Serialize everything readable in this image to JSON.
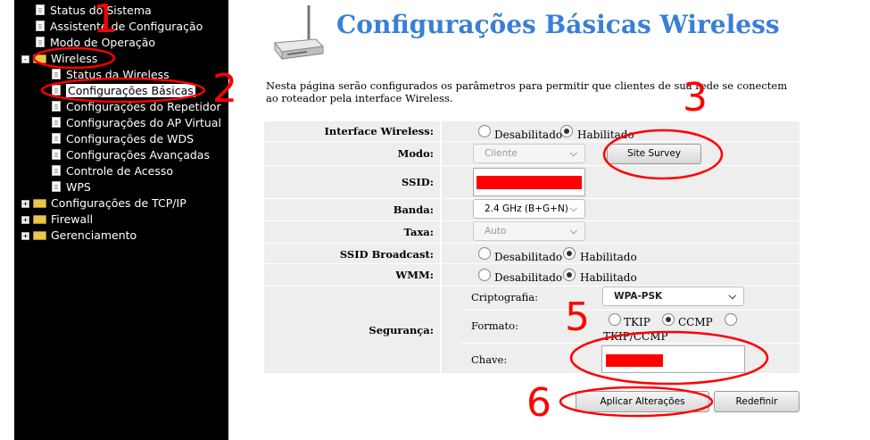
{
  "sidebar": {
    "items": [
      {
        "label": "Status do Sistema",
        "icon": "document-icon"
      },
      {
        "label": "Assistente de Configuração",
        "icon": "document-icon"
      },
      {
        "label": "Modo de Operação",
        "icon": "document-icon"
      },
      {
        "label": "Wireless",
        "icon": "folder-open-icon",
        "expander": "-"
      },
      {
        "label": "Status da Wireless",
        "icon": "document-icon"
      },
      {
        "label": "Configurações Básicas",
        "icon": "document-icon",
        "selected": true
      },
      {
        "label": "Configurações do Repetidor",
        "icon": "document-icon"
      },
      {
        "label": "Configurações do AP Virtual",
        "icon": "document-icon"
      },
      {
        "label": "Configurações de WDS",
        "icon": "document-icon"
      },
      {
        "label": "Configurações Avançadas",
        "icon": "document-icon"
      },
      {
        "label": "Controle de Acesso",
        "icon": "document-icon"
      },
      {
        "label": "WPS",
        "icon": "document-icon"
      },
      {
        "label": "Configurações de TCP/IP",
        "icon": "folder-icon",
        "expander": "+"
      },
      {
        "label": "Firewall",
        "icon": "folder-icon",
        "expander": "+"
      },
      {
        "label": "Gerenciamento",
        "icon": "folder-icon",
        "expander": "+"
      }
    ]
  },
  "header": {
    "title": "Configurações Básicas Wireless",
    "description": "Nesta página serão configurados os parâmetros para permitir que clientes de sua rede se conectem ao roteador pela interface Wireless."
  },
  "form": {
    "interface": {
      "label": "Interface Wireless:",
      "opt1": "Desabilitado",
      "opt2": "Habilitado",
      "selected": "Habilitado"
    },
    "modo": {
      "label": "Modo:",
      "value": "Cliente",
      "button": "Site Survey"
    },
    "ssid": {
      "label": "SSID:"
    },
    "banda": {
      "label": "Banda:",
      "value": "2.4 GHz (B+G+N)"
    },
    "taxa": {
      "label": "Taxa:",
      "value": "Auto"
    },
    "broadcast": {
      "label": "SSID Broadcast:",
      "opt1": "Desabilitado",
      "opt2": "Habilitado",
      "selected": "Habilitado"
    },
    "wmm": {
      "label": "WMM:",
      "opt1": "Desabilitado",
      "opt2": "Habilitado",
      "selected": "Habilitado"
    },
    "seguranca": {
      "label": "Segurança:",
      "cripto_label": "Criptografia:",
      "cripto_value": "WPA-PSK",
      "formato_label": "Formato:",
      "formato_opts": [
        "TKIP",
        "CCMP",
        "TKIP/CCMP"
      ],
      "formato_selected": "CCMP",
      "chave_label": "Chave:"
    },
    "apply_button": "Aplicar Alterações",
    "reset_button": "Redefinir"
  },
  "annotations": {
    "numbers": [
      "1",
      "2",
      "3",
      "5",
      "6"
    ],
    "color": "#ff0000"
  },
  "colors": {
    "title": "#3a7fd5",
    "sidebar_bg": "#000000",
    "row_bg": "#eeeeee",
    "redaction": "#ff0000"
  }
}
